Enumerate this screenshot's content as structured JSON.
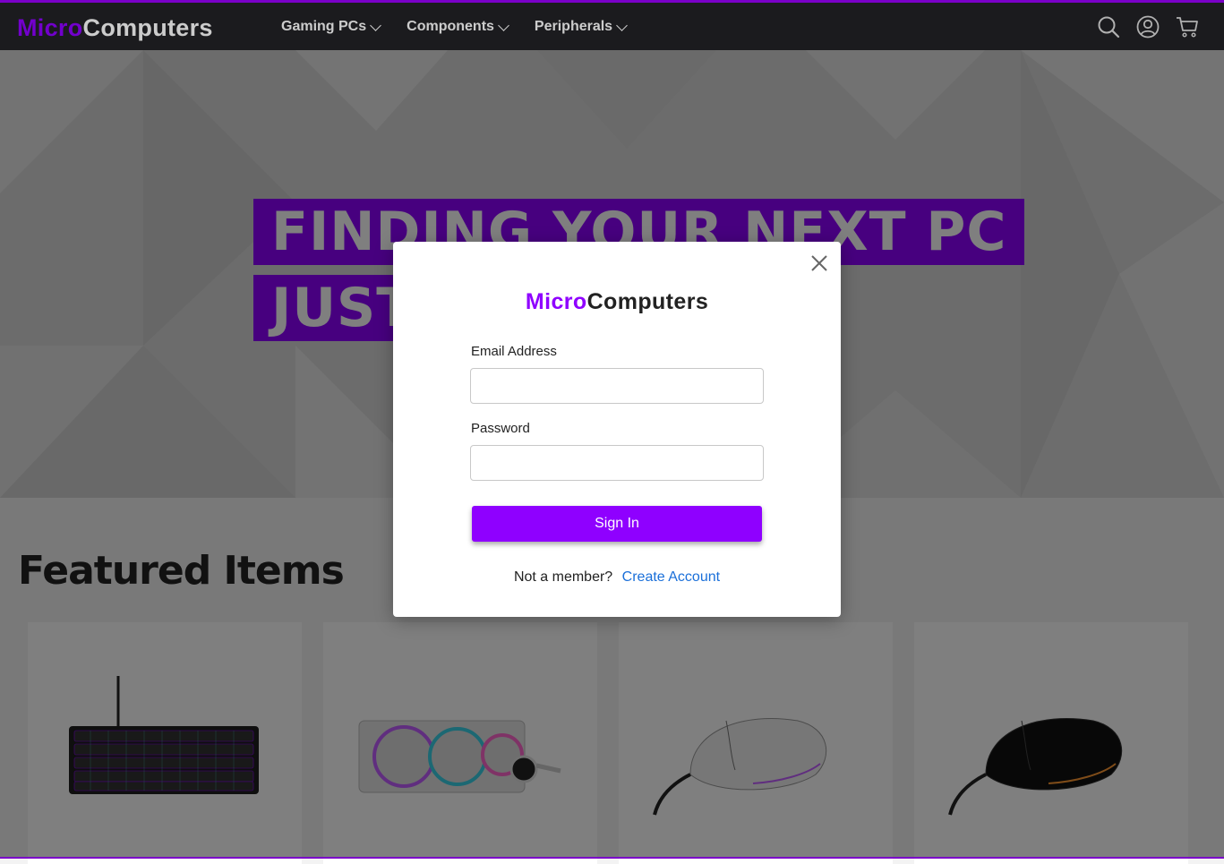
{
  "navbar": {
    "brand_micro": "Micro",
    "brand_computers": "Computers",
    "links": [
      {
        "label": "Gaming PCs"
      },
      {
        "label": "Components"
      },
      {
        "label": "Peripherals"
      }
    ],
    "icons": [
      "search-icon",
      "account-icon",
      "cart-icon"
    ]
  },
  "hero": {
    "line1": "FINDING YOUR NEXT PC",
    "line2": "JUST"
  },
  "featured": {
    "title": "Featured Items",
    "products": [
      {
        "image": "keyboard"
      },
      {
        "image": "liquid-cooler"
      },
      {
        "image": "white-mouse"
      },
      {
        "image": "black-mouse"
      }
    ]
  },
  "modal": {
    "brand_micro": "Micro",
    "brand_computers": "Computers",
    "email_label": "Email Address",
    "email_value": "",
    "password_label": "Password",
    "password_value": "",
    "signin_label": "Sign In",
    "member_text": "Not a member?",
    "create_account_label": "Create Account"
  },
  "colors": {
    "accent": "#8f00ff",
    "navbar_bg": "#222226",
    "link": "#1a6fd9"
  }
}
